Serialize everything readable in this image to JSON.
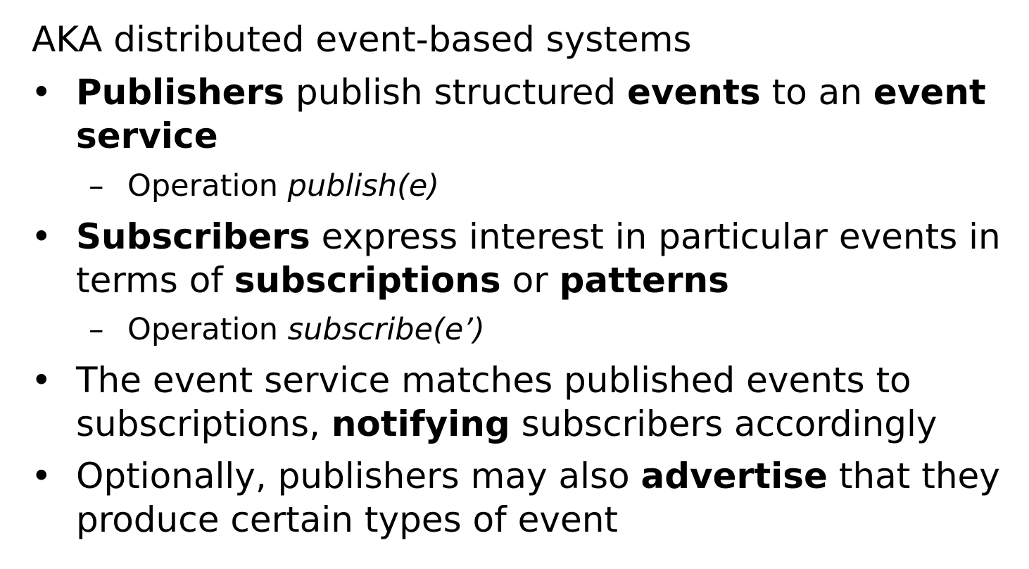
{
  "intro": "AKA distributed event-based systems",
  "bullet_symbol": "•",
  "sub_symbol": "–",
  "bullets": [
    {
      "segments": [
        {
          "text": "Publishers",
          "bold": true
        },
        {
          "text": " publish structured ",
          "bold": false
        },
        {
          "text": "events",
          "bold": true
        },
        {
          "text": " to an ",
          "bold": false
        },
        {
          "text": "event service",
          "bold": true
        }
      ],
      "sub": {
        "prefix": "Operation ",
        "italic": "publish(e)"
      }
    },
    {
      "segments": [
        {
          "text": "Subscribers",
          "bold": true
        },
        {
          "text": " express interest in particular events in terms of ",
          "bold": false
        },
        {
          "text": "subscriptions",
          "bold": true
        },
        {
          "text": " or ",
          "bold": false
        },
        {
          "text": "patterns",
          "bold": true
        }
      ],
      "sub": {
        "prefix": "Operation ",
        "italic": "subscribe(e’)"
      }
    },
    {
      "segments": [
        {
          "text": "The event service matches published events to subscriptions, ",
          "bold": false
        },
        {
          "text": "notifying",
          "bold": true
        },
        {
          "text": " subscribers accordingly",
          "bold": false
        }
      ]
    },
    {
      "segments": [
        {
          "text": "Optionally, publishers may also ",
          "bold": false
        },
        {
          "text": "advertise",
          "bold": true
        },
        {
          "text": " that they produce certain types of event",
          "bold": false
        }
      ]
    }
  ]
}
